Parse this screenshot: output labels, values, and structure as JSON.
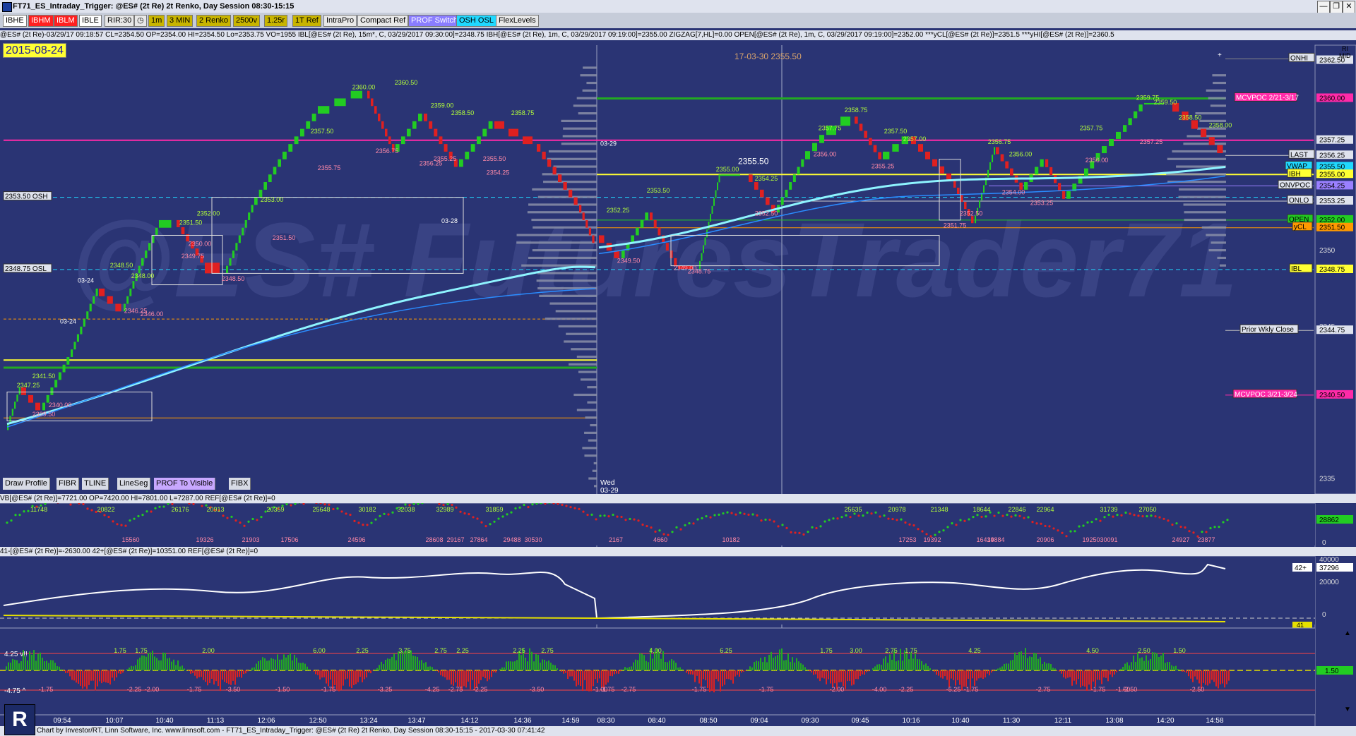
{
  "window": {
    "title": "FT71_ES_Intraday_Trigger: @ES# (2t Re) 2t Renko, Day Session 08:30-15:15",
    "minimize": "—",
    "restore": "❐",
    "close": "✕"
  },
  "toolbar": {
    "buttons": [
      {
        "label": "IBHE",
        "bg": "#ffffff",
        "fg": "#000000"
      },
      {
        "label": "IBHM",
        "bg": "#ff2020",
        "fg": "#ffffff"
      },
      {
        "label": "IBLM",
        "bg": "#ff2020",
        "fg": "#ffffff"
      },
      {
        "label": "IBLE",
        "bg": "#ffffff",
        "fg": "#000000"
      },
      {
        "label": "RIR:30",
        "bg": "#e8e8e8",
        "fg": "#000000"
      },
      {
        "label": "1m",
        "bg": "#c8b400",
        "fg": "#000000"
      },
      {
        "label": "3 MIN",
        "bg": "#c8b400",
        "fg": "#000000"
      },
      {
        "label": "2 Renko",
        "bg": "#c8b400",
        "fg": "#000000"
      },
      {
        "label": "2500v",
        "bg": "#c8b400",
        "fg": "#000000"
      },
      {
        "label": "1.25r",
        "bg": "#c8b400",
        "fg": "#000000"
      },
      {
        "label": "1T Ref",
        "bg": "#c8b400",
        "fg": "#000000"
      },
      {
        "label": "IntraPro",
        "bg": "#e8e8e8",
        "fg": "#000000"
      },
      {
        "label": "Compact Ref",
        "bg": "#e8e8e8",
        "fg": "#000000"
      },
      {
        "label": "PROF Switch",
        "bg": "#8a7dff",
        "fg": "#ffffff"
      },
      {
        "label": "OSH OSL",
        "bg": "#20d8ff",
        "fg": "#000000"
      },
      {
        "label": "FlexLevels",
        "bg": "#e8e8e8",
        "fg": "#000000"
      }
    ]
  },
  "infobar": "@ES# (2t Re)-03/29/17 09:18:57 CL=2354.50 OP=2354.00 HI=2354.50 Lo=2353.75 VO=1955  IBL[@ES# (2t Re), 15m*, C, 03/29/2017 09:30:00]=2348.75  IBH[@ES# (2t Re), 1m, C, 03/29/2017 09:19:00]=2355.00  ZIGZAG[7,HL]=0.00  OPEN[@ES# (2t Re), 1m, C, 03/29/2017 09:19:00]=2352.00  ***yCL[@ES# (2t Re)]=2351.5  ***yHI[@ES# (2t Re)]=2360.5",
  "date_box": "2015-08-24",
  "watermark": "@ES# FuturesTrader71",
  "chart_header": "17-03-30   2355.50",
  "cursor_price": "2355.50",
  "session_labels": {
    "d1": "03-28",
    "d2": "03-29",
    "d3": "03-24",
    "d4": "03-24",
    "d5": "03-29",
    "wed": "Wed",
    "wed_date": "03-29"
  },
  "level_labels": [
    {
      "text": "ONHI",
      "color": "#dfe3ee",
      "fg": "#000"
    },
    {
      "text": "MCVPOC 2/21-3/17",
      "color": "#ff2aa8",
      "fg": "#fff"
    },
    {
      "text": "LAST",
      "color": "#dfe3ee",
      "fg": "#000"
    },
    {
      "text": "VWAP",
      "color": "#20d8ff",
      "fg": "#000"
    },
    {
      "text": "IBH",
      "color": "#ffff33",
      "fg": "#000"
    },
    {
      "text": "ONVPOC",
      "color": "#dfe3ee",
      "fg": "#000"
    },
    {
      "text": "ONLO",
      "color": "#dfe3ee",
      "fg": "#000"
    },
    {
      "text": "OPEN",
      "color": "#22cc22",
      "fg": "#000"
    },
    {
      "text": "yCL",
      "color": "#ff9900",
      "fg": "#000"
    },
    {
      "text": "IBL",
      "color": "#ffff33",
      "fg": "#000"
    },
    {
      "text": "Prior Wkly Close",
      "color": "#dfe3ee",
      "fg": "#000"
    },
    {
      "text": "MCVPOC 3/21-3/24",
      "color": "#ff2aa8",
      "fg": "#fff"
    },
    {
      "text": "2353.50 OSH",
      "color": "#dfe3ee",
      "fg": "#000"
    },
    {
      "text": "2348.75 OSL",
      "color": "#dfe3ee",
      "fg": "#000"
    }
  ],
  "price_axis": {
    "ticks": [
      "2362.50",
      "2360.00",
      "2357.25",
      "2356.25",
      "2355.50",
      "2355.00",
      "2354.25",
      "2353.25",
      "2352.00",
      "2351.50",
      "2350",
      "2348.75",
      "2345",
      "2344.75",
      "2340.50",
      "2335"
    ],
    "label_colors": {
      "2362.50": "#dfe3ee",
      "2360.00": "#ff2aa8",
      "2357.25": "#dfe3ee",
      "2356.25": "#dfe3ee",
      "2355.50": "#20d8ff",
      "2355.00": "#ffff33",
      "2354.25": "#9a80ff",
      "2353.25": "#dfe3ee",
      "2352.00": "#22cc22",
      "2351.50": "#ff9900",
      "2350": "none",
      "2348.75": "#ffff33",
      "2345": "none",
      "2344.75": "#dfe3ee",
      "2340.50": "#ff2aa8",
      "2335": "none"
    }
  },
  "swing_labels": [
    "2360.00",
    "2360.50",
    "2359.00",
    "2358.50",
    "2358.75",
    "2357.50",
    "2356.75",
    "2355.75",
    "2355.25",
    "2356.25",
    "2355.50",
    "2354.25",
    "2353.00",
    "2352.00",
    "2351.50",
    "2351.50",
    "2350.00",
    "2349.75",
    "2348.50",
    "2348.50",
    "2348.00",
    "2346.25",
    "2346.00",
    "2341.50",
    "2340.00",
    "2339.50",
    "2347.25",
    "2353.50",
    "2352.25",
    "2349.50",
    "2349.00",
    "2348.75",
    "2355.00",
    "2354.25",
    "2352.50",
    "2358.75",
    "2357.75",
    "2357.50",
    "2357.00",
    "2356.00",
    "2355.25",
    "2356.75",
    "2356.00",
    "2354.00",
    "2353.25",
    "2351.75",
    "2352.50",
    "2357.75",
    "2359.75",
    "2359.50",
    "2358.50",
    "2358.00",
    "2357.25",
    "2356.00"
  ],
  "toolbox": [
    "Draw Profile",
    "FIBR",
    "TLINE",
    "LineSeg",
    "PROF To Visible",
    "FIBX"
  ],
  "panel1": {
    "header": "VB[@ES# (2t Re)]=7721.00 OP=7420.00 HI=7801.00 L=7287.00  REF[@ES# (2t Re)]=0",
    "value_label": "28862",
    "zero_label": "0",
    "peaks_up": [
      "11748",
      "20822",
      "26176",
      "20913",
      "20359",
      "25648",
      "30182",
      "32038",
      "32989",
      "31859",
      "25635",
      "20978",
      "21348",
      "18644",
      "22846",
      "22964",
      "31739",
      "27050"
    ],
    "peaks_dn": [
      "15560",
      "19326",
      "21903",
      "17506",
      "24596",
      "28608",
      "29167",
      "27864",
      "29488",
      "30530",
      "2167",
      "4660",
      "10182",
      "17253",
      "19392",
      "16439",
      "14884",
      "20906",
      "19250",
      "30091",
      "24927",
      "23877"
    ]
  },
  "panel2": {
    "header": "41-[@ES# (2t Re)]=-2630.00  42+[@ES# (2t Re)]=10351.00  REF[@ES# (2t Re)]=0",
    "value_label": "37296",
    "value_name": "42+",
    "tick_top": "40000",
    "tick_mid": "20000",
    "tick_zero": "0",
    "tick_small": "41"
  },
  "panel3": {
    "top_label": "4.25 v!!",
    "bottom_label": "-4.75 ^",
    "pos_labels": [
      "1.75",
      "1.75",
      "2.00",
      "6.00",
      "2.25",
      "3.75",
      "2.75",
      "2.25",
      "2.25",
      "2.75",
      "4.00",
      "6.25",
      "1.75",
      "3.00",
      "2.75",
      "1.75",
      "4.25",
      "4.50",
      "2.50",
      "1.50"
    ],
    "neg_labels": [
      "-1.75",
      "-2.25",
      "-2.00",
      "-1.75",
      "-3.50",
      "-1.50",
      "-1.75",
      "-3.25",
      "-4.25",
      "-2.75",
      "-2.25",
      "-3.50",
      "-1.00",
      "-1.75",
      "-2.75",
      "-1.75",
      "-1.75",
      "-2.00",
      "-4.00",
      "-2.25",
      "-5.25",
      "-1.75",
      "-2.75",
      "-1.75",
      "-1.50",
      "-2.50",
      "-2.50"
    ],
    "axis_value": "1.50"
  },
  "time_axis": [
    "09:54",
    "10:07",
    "10:40",
    "11:13",
    "12:06",
    "12:50",
    "13:24",
    "13:47",
    "14:12",
    "14:36",
    "14:59",
    "08:30",
    "08:40",
    "08:50",
    "09:04",
    "09:30",
    "09:45",
    "10:16",
    "10:40",
    "11:30",
    "12:11",
    "13:08",
    "14:20",
    "14:58"
  ],
  "footer": "Chart by Investor/RT, Linn Software, Inc. www.linnsoft.com - FT71_ES_Intraday_Trigger: @ES# (2t Re) 2t Renko, Day Session 08:30-15:15 - 2017-03-30 07:41:42",
  "logo_letter": "R",
  "right_panel_labels": {
    "mid": "MID",
    "ri": "RI"
  }
}
